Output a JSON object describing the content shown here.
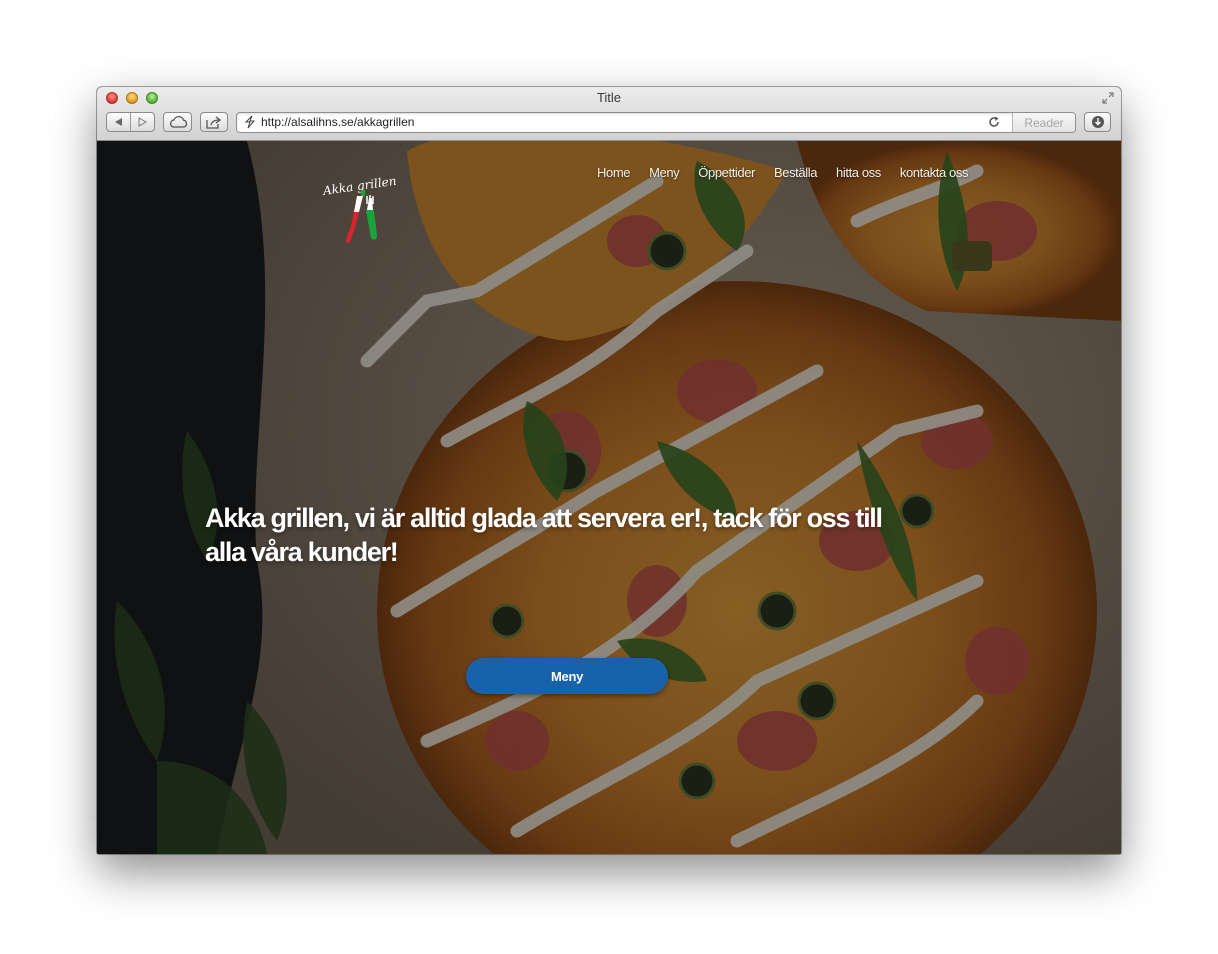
{
  "window": {
    "title": "Title"
  },
  "toolbar": {
    "back_icon": "back-arrow-icon",
    "forward_icon": "forward-arrow-icon",
    "icloud_icon": "cloud-icon",
    "share_icon": "share-icon",
    "url": "http://alsalihns.se/akkagrillen",
    "reader_label": "Reader",
    "download_icon": "download-icon"
  },
  "site": {
    "logo_text": "Akka grillen",
    "nav": [
      {
        "label": "Home"
      },
      {
        "label": "Meny"
      },
      {
        "label": "Öppettider"
      },
      {
        "label": "Beställa"
      },
      {
        "label": "hitta oss"
      },
      {
        "label": "kontakta oss"
      }
    ],
    "headline": "Akka grillen, vi är alltid glada att servera er!, tack för oss till alla våra kunder!",
    "cta_label": "Meny"
  },
  "colors": {
    "cta_background": "#1762ab",
    "logo_red": "#d8242c",
    "logo_green": "#1aa33d"
  }
}
